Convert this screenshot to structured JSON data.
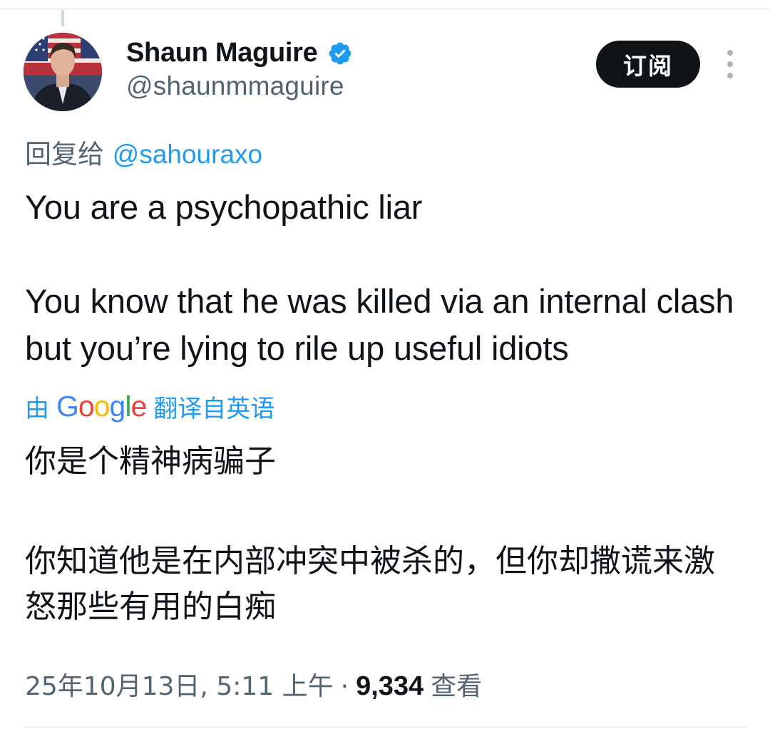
{
  "author": {
    "display_name": "Shaun Maguire",
    "handle": "@shaunmmaguire",
    "verified": true,
    "verified_color": "#1d9bf0"
  },
  "actions": {
    "subscribe_label": "订阅",
    "more_icon": "more-vertical-icon"
  },
  "reply": {
    "prefix": "回复给",
    "mention": "@sahouraxo"
  },
  "tweet": {
    "paragraph1": "You are a psychopathic liar",
    "paragraph2": "You know that he was killed via an internal clash but you’re lying to rile up useful idiots"
  },
  "translation": {
    "by": "由",
    "provider": "Google",
    "label": "翻译自英语",
    "paragraph1": "你是个精神病骗子",
    "paragraph2": "你知道他是在内部冲突中被杀的，但你却撒谎来激怒那些有用的白痴"
  },
  "meta": {
    "timestamp": "25年10月13日, 5:11 上午",
    "separator": "·",
    "views_count": "9,334",
    "views_label": "查看"
  },
  "colors": {
    "text_primary": "#0f1419",
    "text_secondary": "#536471",
    "link": "#1d9bf0",
    "button_bg": "#0f1419"
  }
}
